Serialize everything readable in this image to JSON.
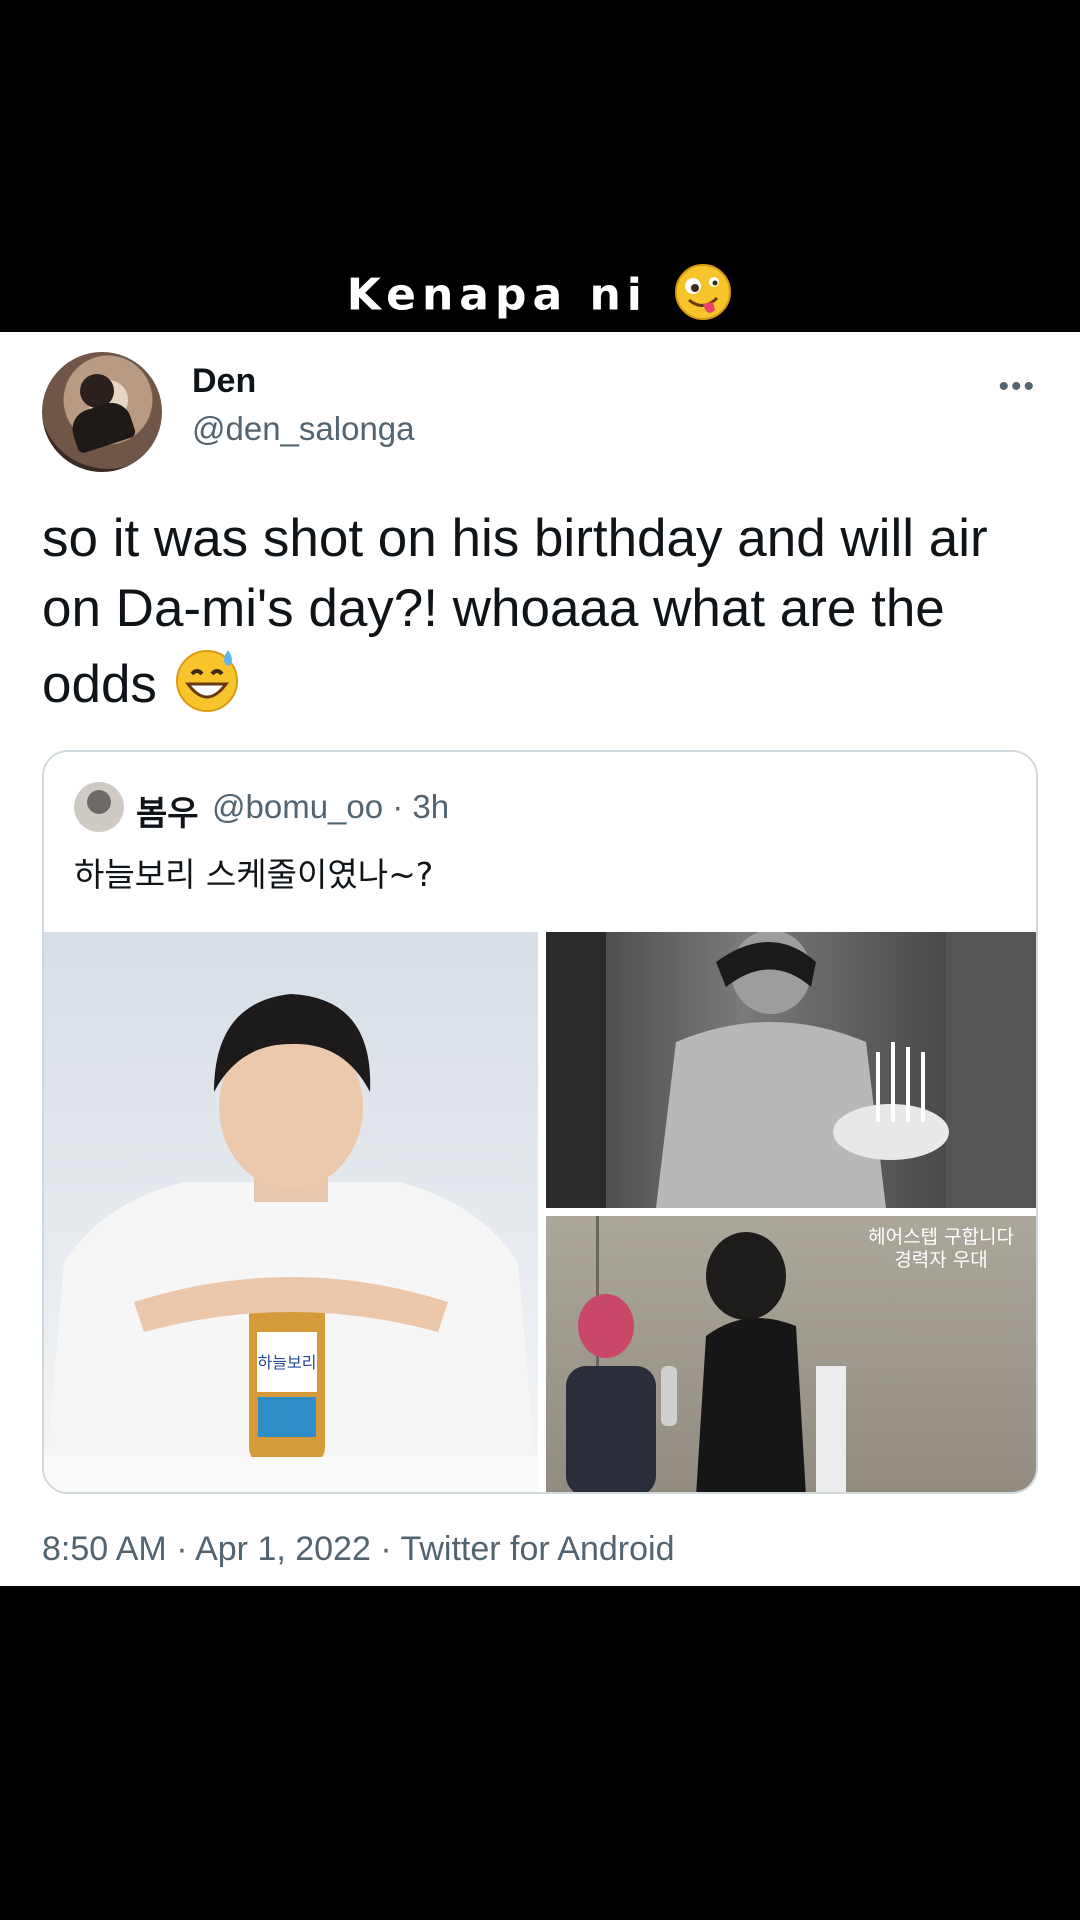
{
  "overlay": {
    "caption": "Kenapa ni"
  },
  "tweet": {
    "author_name": "Den",
    "author_handle": "@den_salonga",
    "more_label": "•••",
    "text": "so it was shot on his birthday and will air on Da-mi's day?! whoaaa what are the odds",
    "timestamp": "8:50 AM · Apr 1, 2022 · Twitter for Android"
  },
  "quote_tweet": {
    "author_name": "봄우",
    "author_handle_time": "@bomu_oo · 3h",
    "text": "하늘보리 스케줄이였나~?",
    "image_caption_line1": "헤어스텝 구합니다",
    "image_caption_line2": "경력자 우대",
    "bottle_label": "하늘보리"
  },
  "colors": {
    "text_primary": "#0f1419",
    "text_secondary": "#536471",
    "border": "#cfd9de"
  }
}
